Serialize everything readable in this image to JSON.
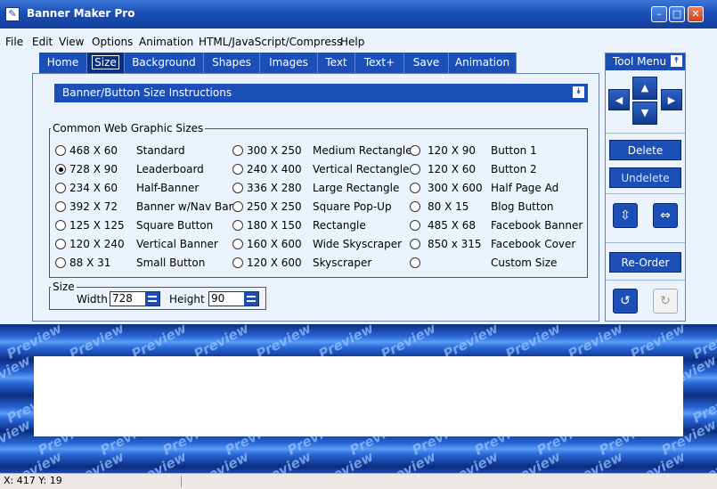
{
  "window": {
    "title": "Banner Maker Pro",
    "minimize": "–",
    "maximize": "□",
    "close": "✕"
  },
  "menu": [
    "File",
    "Edit",
    "View",
    "Options",
    "Animation",
    "HTML/JavaScript/Compress",
    "Help"
  ],
  "tabs": [
    "Home",
    "Size",
    "Background",
    "Shapes",
    "Images",
    "Text",
    "Text+",
    "Save",
    "Animation"
  ],
  "active_tab": "Size",
  "instructions": {
    "label": "Banner/Button Size Instructions",
    "icon": "double-chevron-down-icon"
  },
  "common_sizes": {
    "legend": "Common Web Graphic Sizes",
    "selected": "728 X 90",
    "col1": [
      [
        "468 X 60",
        "Standard"
      ],
      [
        "728 X 90",
        "Leaderboard"
      ],
      [
        "234 X 60",
        "Half-Banner"
      ],
      [
        "392 X 72",
        "Banner w/Nav Bar"
      ],
      [
        "125 X 125",
        "Square Button"
      ],
      [
        "120 X 240",
        "Vertical Banner"
      ],
      [
        "88 X 31",
        "Small Button"
      ]
    ],
    "col2": [
      [
        "300 X 250",
        "Medium Rectangle"
      ],
      [
        "240 X 400",
        "Vertical Rectangle"
      ],
      [
        "336 X 280",
        "Large Rectangle"
      ],
      [
        "250 X 250",
        "Square Pop-Up"
      ],
      [
        "180 X 150",
        "Rectangle"
      ],
      [
        "160 X 600",
        "Wide Skyscraper"
      ],
      [
        "120 X 600",
        "Skyscraper"
      ]
    ],
    "col3": [
      [
        "120 X 90",
        "Button 1"
      ],
      [
        "120 X 60",
        "Button 2"
      ],
      [
        "300 X 600",
        "Half Page Ad"
      ],
      [
        "80  X  15",
        "Blog Button"
      ],
      [
        "485 X 68",
        "Facebook Banner"
      ],
      [
        "850 x 315",
        "Facebook Cover"
      ],
      [
        "",
        "Custom Size"
      ]
    ]
  },
  "size": {
    "legend": "Size",
    "width_label": "Width",
    "width_value": "728",
    "height_label": "Height",
    "height_value": "90"
  },
  "tool_menu": {
    "title": "Tool Menu",
    "delete": "Delete",
    "undelete": "Undelete",
    "reorder": "Re-Order"
  },
  "preview": {
    "watermark": "Preview"
  },
  "status": {
    "coords": "X: 417  Y: 19"
  }
}
